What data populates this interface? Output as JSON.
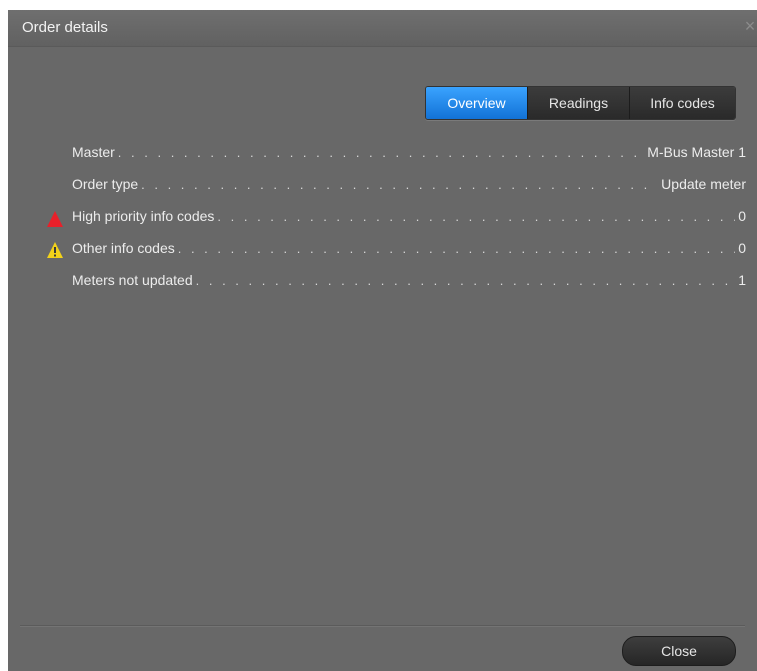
{
  "dialog": {
    "title": "Order details",
    "close_glyph": "×"
  },
  "tabs": [
    {
      "label": "Overview",
      "active": true
    },
    {
      "label": "Readings",
      "active": false
    },
    {
      "label": "Info codes",
      "active": false
    }
  ],
  "rows": [
    {
      "label": "Master",
      "value": "M-Bus Master 1",
      "icon": null
    },
    {
      "label": "Order type",
      "value": "Update meter",
      "icon": null
    },
    {
      "label": "High priority info codes",
      "value": "0",
      "icon": "red-warning-icon"
    },
    {
      "label": "Other info codes",
      "value": "0",
      "icon": "yellow-warning-icon"
    },
    {
      "label": "Meters not updated",
      "value": "1",
      "icon": null
    }
  ],
  "footer": {
    "close_label": "Close"
  },
  "colors": {
    "background": "#686868",
    "active_tab": "#1f86ee",
    "red_warning": "#e8202a",
    "yellow_warning": "#f3d21a"
  }
}
